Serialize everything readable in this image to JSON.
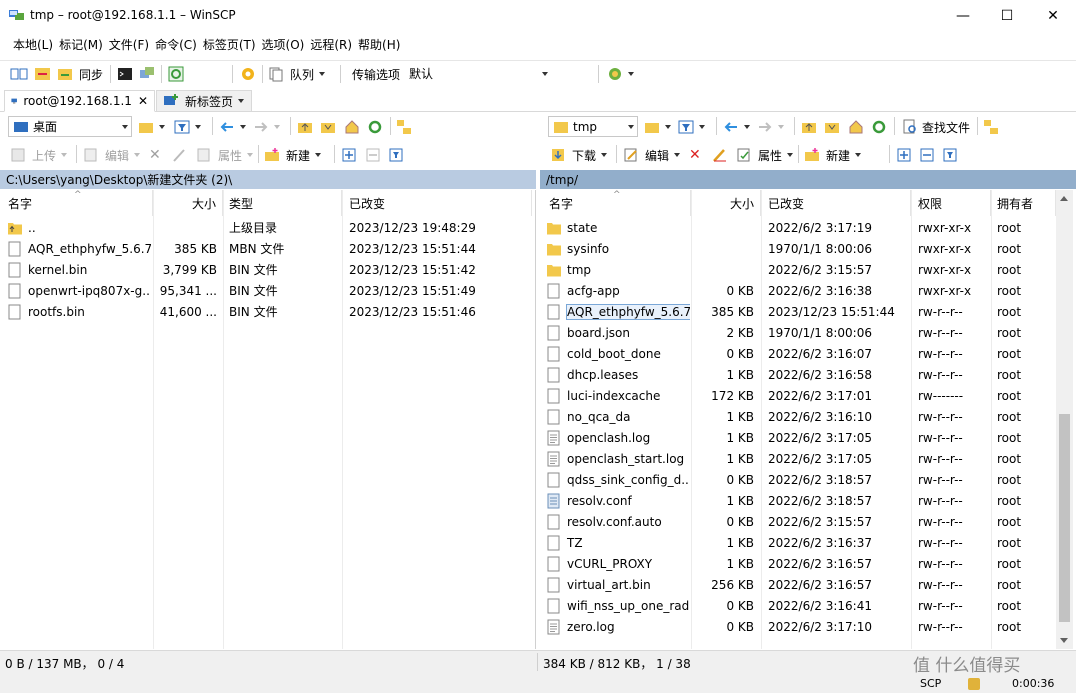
{
  "window": {
    "title": "tmp – root@192.168.1.1 – WinSCP",
    "min_glyph": "—",
    "max_glyph": "☐",
    "close_glyph": "✕"
  },
  "menu": [
    "本地(L)",
    "标记(M)",
    "文件(F)",
    "命令(C)",
    "标签页(T)",
    "选项(O)",
    "远程(R)",
    "帮助(H)"
  ],
  "toolbar": {
    "sync_label": "同步",
    "queue_label": "队列",
    "transfer_label": "传输选项",
    "transfer_value": "默认"
  },
  "tabs": {
    "active": "root@192.168.1.1",
    "new_tab": "新标签页"
  },
  "left_panel": {
    "location": "桌面",
    "upload": "上传",
    "edit": "编辑",
    "props": "属性",
    "new": "新建",
    "path": "C:\\Users\\yang\\Desktop\\新建文件夹 (2)\\",
    "columns": {
      "name": "名字",
      "size": "大小",
      "type": "类型",
      "changed": "已改变"
    },
    "files": [
      {
        "name": "..",
        "size": "",
        "type": "上级目录",
        "changed": "2023/12/23 19:48:29",
        "icon": "parent-dir"
      },
      {
        "name": "AQR_ethphyfw_5.6.7...",
        "size": "385 KB",
        "type": "MBN 文件",
        "changed": "2023/12/23 15:51:44",
        "icon": "file"
      },
      {
        "name": "kernel.bin",
        "size": "3,799 KB",
        "type": "BIN 文件",
        "changed": "2023/12/23 15:51:42",
        "icon": "file"
      },
      {
        "name": "openwrt-ipq807x-g...",
        "size": "95,341 ...",
        "type": "BIN 文件",
        "changed": "2023/12/23 15:51:49",
        "icon": "file"
      },
      {
        "name": "rootfs.bin",
        "size": "41,600 ...",
        "type": "BIN 文件",
        "changed": "2023/12/23 15:51:46",
        "icon": "file"
      }
    ]
  },
  "right_panel": {
    "location": "tmp",
    "download": "下载",
    "edit": "编辑",
    "props": "属性",
    "new": "新建",
    "find": "查找文件",
    "path": "/tmp/",
    "columns": {
      "name": "名字",
      "size": "大小",
      "changed": "已改变",
      "perms": "权限",
      "owner": "拥有者"
    },
    "files": [
      {
        "name": "state",
        "size": "",
        "changed": "2022/6/2 3:17:19",
        "perms": "rwxr-xr-x",
        "owner": "root",
        "icon": "folder"
      },
      {
        "name": "sysinfo",
        "size": "",
        "changed": "1970/1/1 8:00:06",
        "perms": "rwxr-xr-x",
        "owner": "root",
        "icon": "folder"
      },
      {
        "name": "tmp",
        "size": "",
        "changed": "2022/6/2 3:15:57",
        "perms": "rwxr-xr-x",
        "owner": "root",
        "icon": "folder"
      },
      {
        "name": "acfg-app",
        "size": "0 KB",
        "changed": "2022/6/2 3:16:38",
        "perms": "rwxr-xr-x",
        "owner": "root",
        "icon": "file"
      },
      {
        "name": "AQR_ethphyfw_5.6.7...",
        "size": "385 KB",
        "changed": "2023/12/23 15:51:44",
        "perms": "rw-r--r--",
        "owner": "root",
        "icon": "file",
        "selected": true
      },
      {
        "name": "board.json",
        "size": "2 KB",
        "changed": "1970/1/1 8:00:06",
        "perms": "rw-r--r--",
        "owner": "root",
        "icon": "file"
      },
      {
        "name": "cold_boot_done",
        "size": "0 KB",
        "changed": "2022/6/2 3:16:07",
        "perms": "rw-r--r--",
        "owner": "root",
        "icon": "file"
      },
      {
        "name": "dhcp.leases",
        "size": "1 KB",
        "changed": "2022/6/2 3:16:58",
        "perms": "rw-r--r--",
        "owner": "root",
        "icon": "file"
      },
      {
        "name": "luci-indexcache",
        "size": "172 KB",
        "changed": "2022/6/2 3:17:01",
        "perms": "rw-------",
        "owner": "root",
        "icon": "file"
      },
      {
        "name": "no_qca_da",
        "size": "1 KB",
        "changed": "2022/6/2 3:16:10",
        "perms": "rw-r--r--",
        "owner": "root",
        "icon": "file"
      },
      {
        "name": "openclash.log",
        "size": "1 KB",
        "changed": "2022/6/2 3:17:05",
        "perms": "rw-r--r--",
        "owner": "root",
        "icon": "text-file"
      },
      {
        "name": "openclash_start.log",
        "size": "1 KB",
        "changed": "2022/6/2 3:17:05",
        "perms": "rw-r--r--",
        "owner": "root",
        "icon": "text-file"
      },
      {
        "name": "qdss_sink_config_d...",
        "size": "0 KB",
        "changed": "2022/6/2 3:18:57",
        "perms": "rw-r--r--",
        "owner": "root",
        "icon": "file"
      },
      {
        "name": "resolv.conf",
        "size": "1 KB",
        "changed": "2022/6/2 3:18:57",
        "perms": "rw-r--r--",
        "owner": "root",
        "icon": "config-file"
      },
      {
        "name": "resolv.conf.auto",
        "size": "0 KB",
        "changed": "2022/6/2 3:15:57",
        "perms": "rw-r--r--",
        "owner": "root",
        "icon": "file"
      },
      {
        "name": "TZ",
        "size": "1 KB",
        "changed": "2022/6/2 3:16:37",
        "perms": "rw-r--r--",
        "owner": "root",
        "icon": "file"
      },
      {
        "name": "vCURL_PROXY",
        "size": "1 KB",
        "changed": "2022/6/2 3:16:57",
        "perms": "rw-r--r--",
        "owner": "root",
        "icon": "file"
      },
      {
        "name": "virtual_art.bin",
        "size": "256 KB",
        "changed": "2022/6/2 3:16:57",
        "perms": "rw-r--r--",
        "owner": "root",
        "icon": "file"
      },
      {
        "name": "wifi_nss_up_one_rad...",
        "size": "0 KB",
        "changed": "2022/6/2 3:16:41",
        "perms": "rw-r--r--",
        "owner": "root",
        "icon": "file"
      },
      {
        "name": "zero.log",
        "size": "0 KB",
        "changed": "2022/6/2 3:17:10",
        "perms": "rw-r--r--",
        "owner": "root",
        "icon": "text-file"
      }
    ]
  },
  "status": {
    "left": "0 B / 137 MB， 0 / 4",
    "right": "384 KB / 812 KB， 1 / 38",
    "protocol": "SCP",
    "timer": "0:00:36",
    "badge": "值 什么值得买"
  },
  "colors": {
    "left_path_bg": "#b9cbe1",
    "right_path_bg": "#92aecb",
    "folder": "#f2c84b",
    "accent_blue": "#2f6fbf"
  }
}
